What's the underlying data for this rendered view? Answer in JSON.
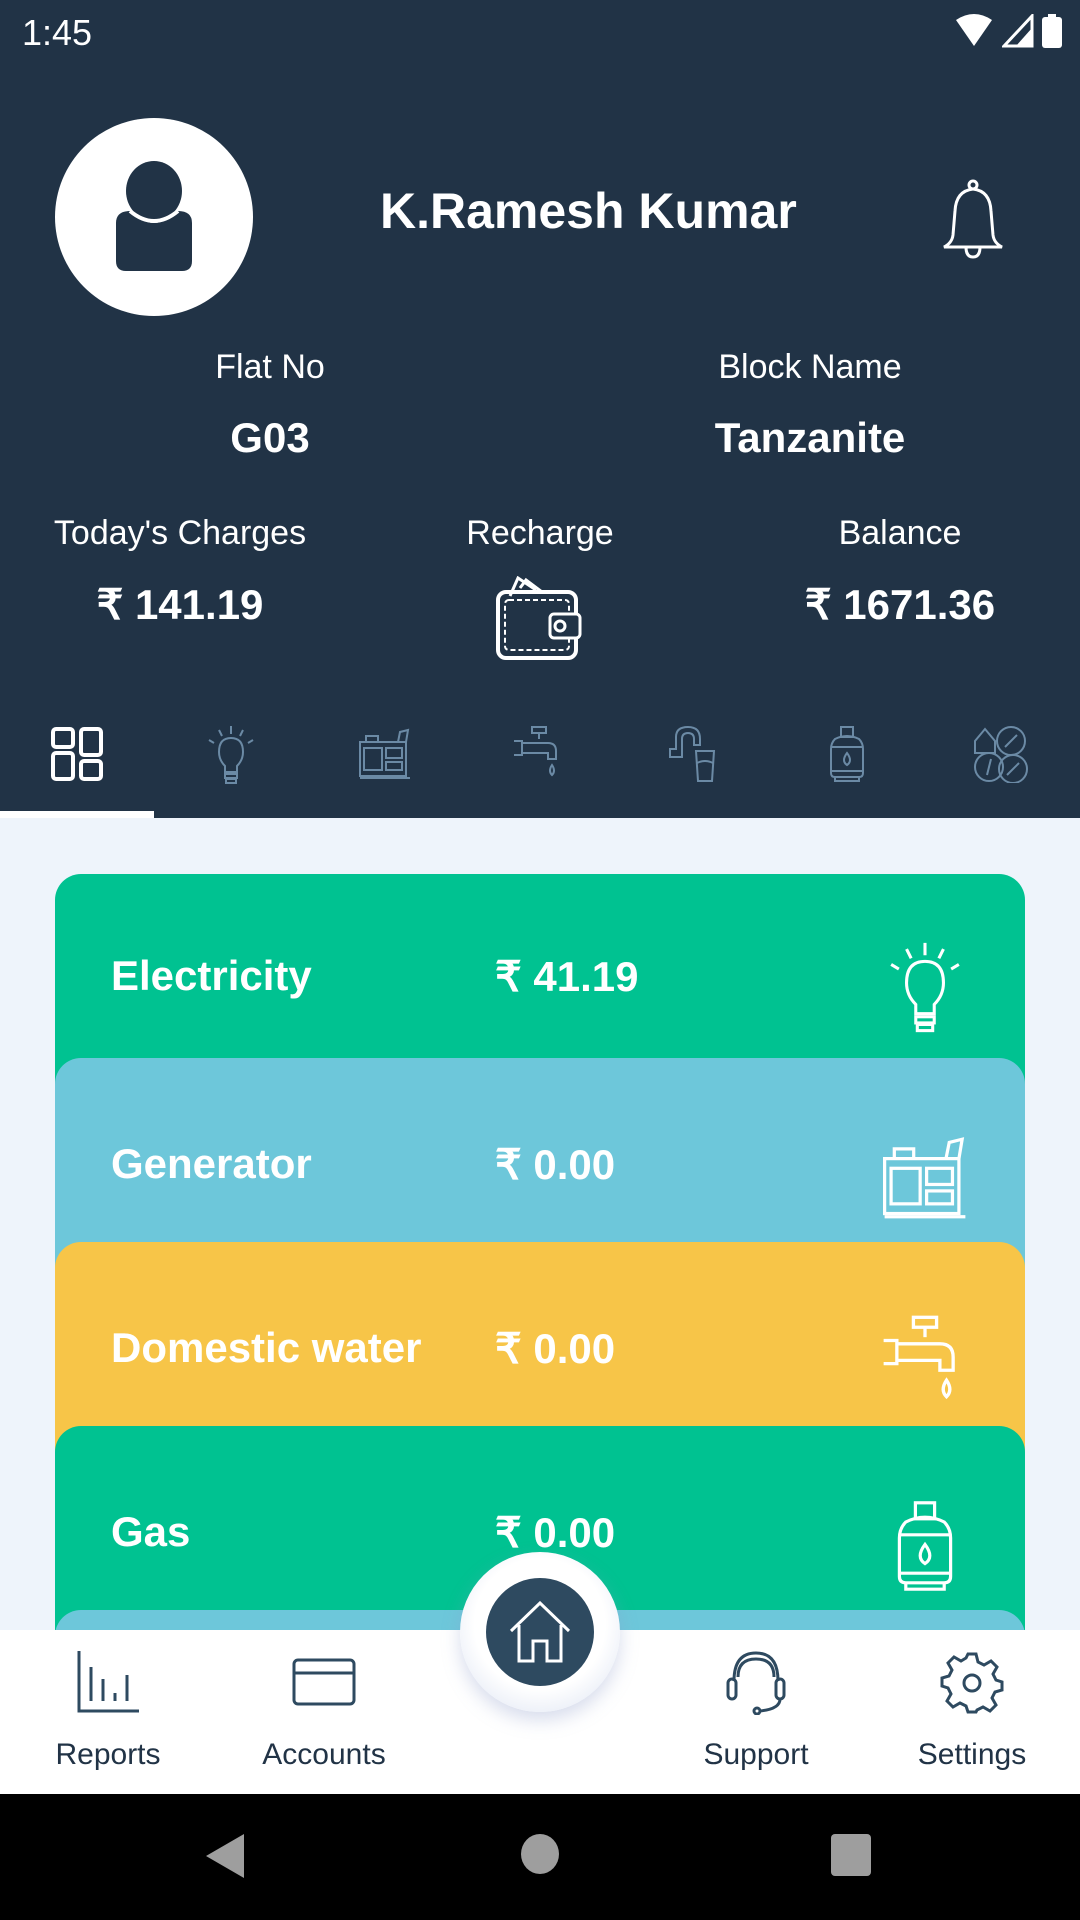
{
  "status_bar": {
    "time": "1:45",
    "icons": [
      "wifi-icon",
      "signal-icon",
      "battery-icon"
    ]
  },
  "profile": {
    "name": "K.Ramesh Kumar",
    "avatar_icon": "user-icon",
    "notification_icon": "bell-icon"
  },
  "flat": {
    "label": "Flat No",
    "value": "G03"
  },
  "block": {
    "label": "Block Name",
    "value": "Tanzanite"
  },
  "charges": {
    "label": "Today's Charges",
    "value": "₹ 141.19"
  },
  "recharge": {
    "label": "Recharge",
    "icon": "wallet-icon"
  },
  "balance": {
    "label": "Balance",
    "value": "₹ 1671.36"
  },
  "tabs": [
    {
      "name": "dashboard",
      "icon": "dashboard-icon",
      "active": true
    },
    {
      "name": "electricity",
      "icon": "bulb-icon",
      "active": false
    },
    {
      "name": "generator",
      "icon": "generator-icon",
      "active": false
    },
    {
      "name": "domestic-water",
      "icon": "tap-icon",
      "active": false
    },
    {
      "name": "drinking-water",
      "icon": "faucet-glass-icon",
      "active": false
    },
    {
      "name": "gas",
      "icon": "gas-cylinder-icon",
      "active": false
    },
    {
      "name": "services",
      "icon": "services-icon",
      "active": false
    }
  ],
  "cards": [
    {
      "label": "Electricity",
      "amount": "₹ 41.19",
      "color": "#00c291",
      "icon": "bulb-icon"
    },
    {
      "label": "Generator",
      "amount": "₹ 0.00",
      "color": "#6dc7da",
      "icon": "generator-icon"
    },
    {
      "label": "Domestic water",
      "amount": "₹ 0.00",
      "color": "#f7c548",
      "icon": "tap-icon"
    },
    {
      "label": "Gas",
      "amount": "₹ 0.00",
      "color": "#00c291",
      "icon": "gas-cylinder-icon"
    },
    {
      "label": "",
      "amount": "",
      "color": "#6dc7da",
      "icon": ""
    }
  ],
  "bottom_nav": {
    "reports": "Reports",
    "accounts": "Accounts",
    "home_icon": "home-icon",
    "support": "Support",
    "settings": "Settings"
  },
  "colors": {
    "header_bg": "#213346",
    "accent_green": "#00c291",
    "accent_blue": "#6dc7da",
    "accent_yellow": "#f7c548",
    "fab": "#2e4a60"
  }
}
